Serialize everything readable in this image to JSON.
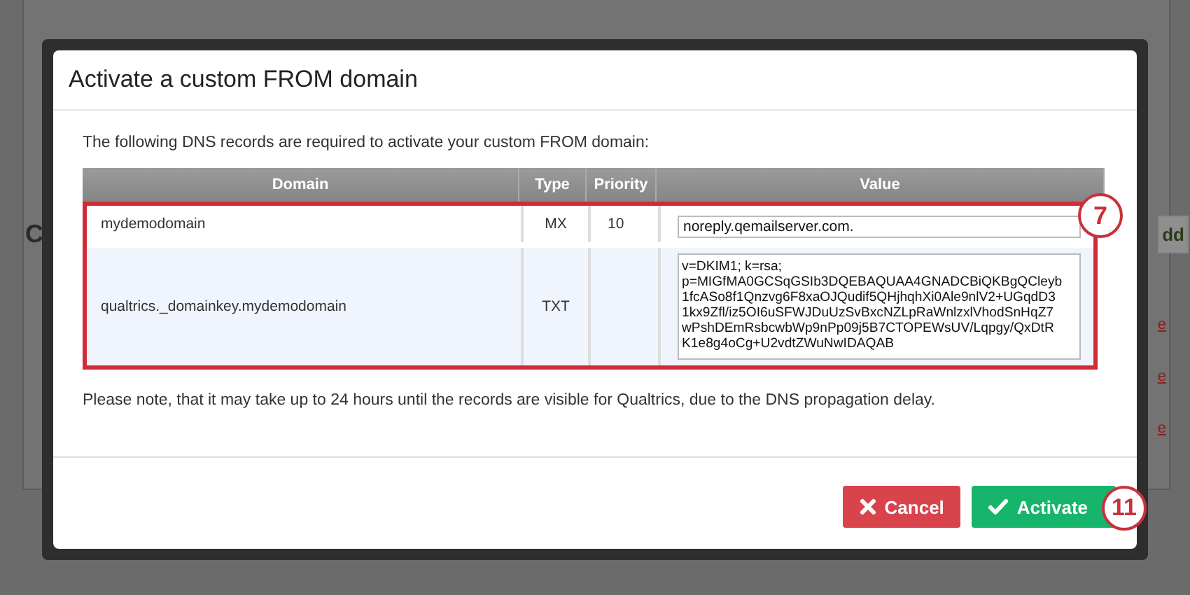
{
  "background": {
    "heading": "C",
    "add_button": "dd",
    "links": [
      "e",
      "e",
      "e"
    ]
  },
  "dialog": {
    "title": "Activate a custom FROM domain",
    "intro": "The following DNS records are required to activate your custom FROM domain:",
    "table": {
      "columns": [
        "Domain",
        "Type",
        "Priority",
        "Value"
      ],
      "rows": [
        {
          "domain": "mydemodomain",
          "type": "MX",
          "priority": "10",
          "value": "noreply.qemailserver.com.",
          "kind": "input"
        },
        {
          "domain": "qualtrics._domainkey.mydemodomain",
          "type": "TXT",
          "value": "v=DKIM1; k=rsa;\np=MIGfMA0GCSqGSIb3DQEBAQUAA4GNADCBiQKBgQCleyb\n1fcASo8f1Qnzvg6F8xaOJQudif5QHjhqhXi0Ale9nlV2+UGqdD3\n1kx9Zfl/iz5OI6uSFWJDuUzSvBxcNZLpRaWnlzxlVhodSnHqZ7\nwPshDEmRsbcwbWp9nPp09j5B7CTOPEWsUV/Lqpgy/QxDtR\nK1e8g4oCg+U2vdtZWuNwIDAQAB",
          "kind": "textarea"
        }
      ],
      "callout": "7"
    },
    "note": "Please note, that it may take up to 24 hours until the records are visible for Qualtrics, due to the DNS propagation delay.",
    "buttons": [
      {
        "label": "Cancel",
        "kind": "cancel"
      },
      {
        "label": "Activate",
        "kind": "confirm",
        "callout": "11"
      }
    ]
  }
}
